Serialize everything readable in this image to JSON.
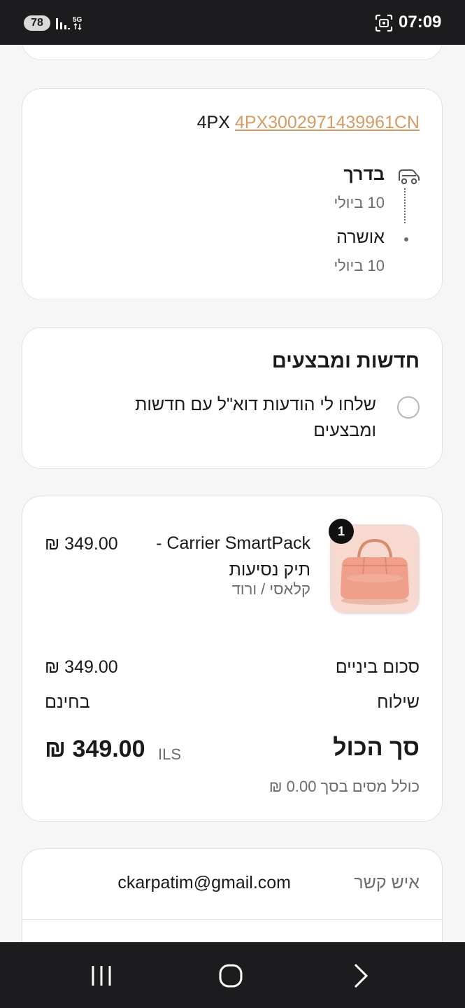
{
  "status_bar": {
    "battery": "78",
    "network": "5G",
    "time": "07:09"
  },
  "tracking": {
    "carrier": "4PX",
    "number": "4PX3002971439961CN",
    "steps": [
      {
        "title": "בדרך",
        "date": "10 ביולי"
      },
      {
        "title": "אושרה",
        "date": "10 ביולי"
      }
    ]
  },
  "news": {
    "title": "חדשות ומבצעים",
    "checkbox_label": "שלחו לי הודעות דוא\"ל עם חדשות ומבצעים",
    "checked": false
  },
  "order": {
    "quantity": "1",
    "product_name": "Carrier SmartPack - תיק נסיעות",
    "variant": "קלאסי / ורוד",
    "line_price": "₪ 349.00",
    "subtotal_label": "סכום ביניים",
    "subtotal_value": "₪ 349.00",
    "shipping_label": "שילוח",
    "shipping_value": "בחינם",
    "total_label": "סך הכול",
    "total_currency": "ILS",
    "total_value": "₪ 349.00",
    "tax_note": "כולל מסים בסך 0.00 ₪"
  },
  "contact": {
    "label": "איש קשר",
    "email": "ckarpatim@gmail.com"
  },
  "nav": {
    "icons": [
      "recent-apps-icon",
      "home-icon",
      "back-icon"
    ]
  }
}
